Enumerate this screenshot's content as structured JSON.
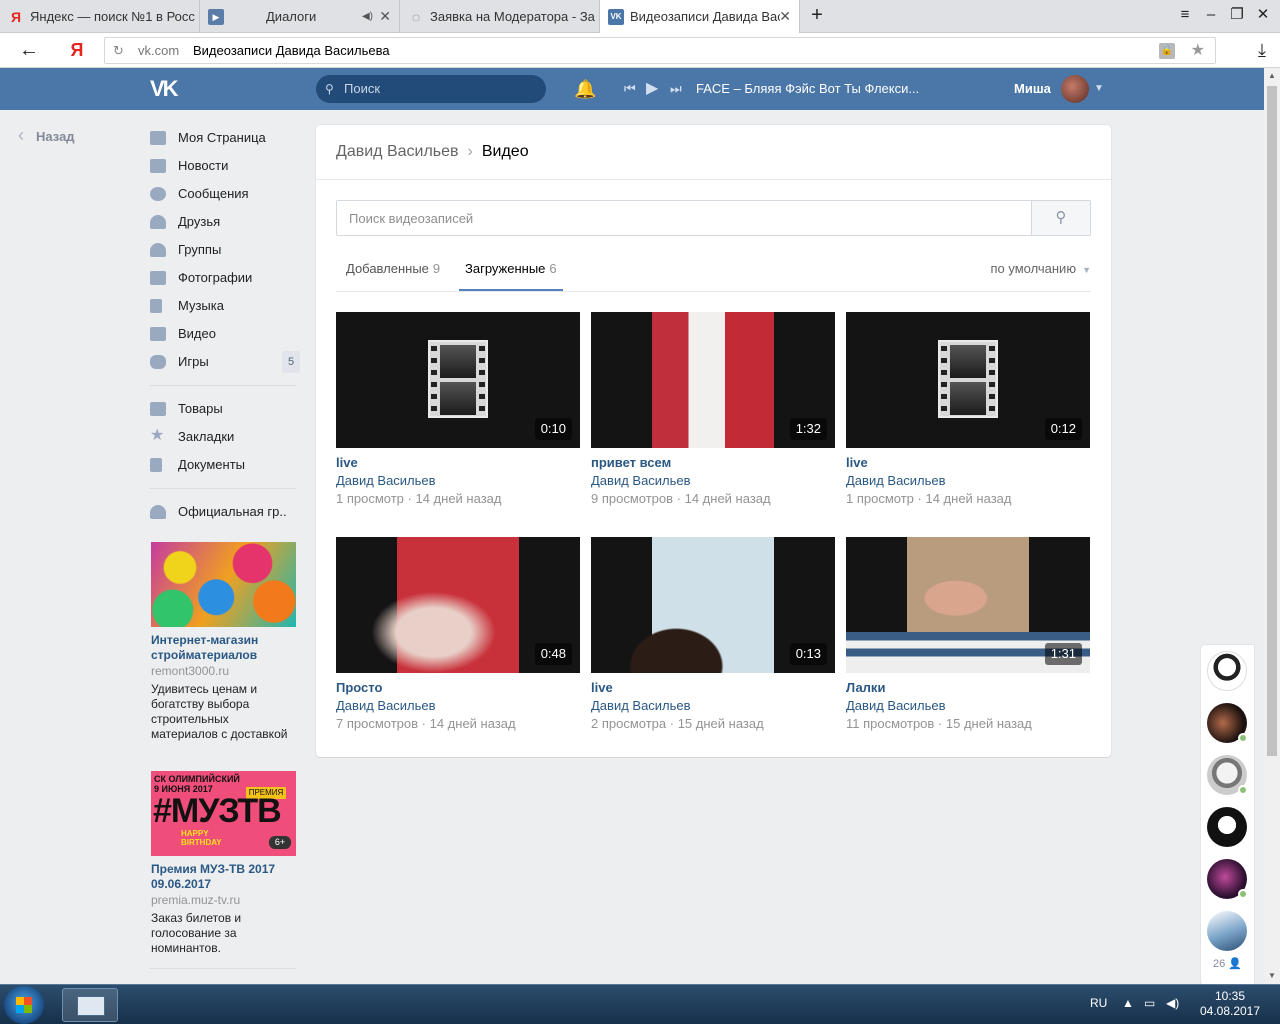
{
  "browser": {
    "tabs": [
      {
        "label": "Яндекс — поиск №1 в Росс",
        "icon": "yandex-icon"
      },
      {
        "label": "Диалоги",
        "icon": "play-icon"
      },
      {
        "label": "Заявка на Модератора - За",
        "icon": "loading-icon"
      },
      {
        "label": "Видеозаписи Давида Вас",
        "icon": "vk-icon"
      }
    ],
    "new_tab": "+",
    "address_domain": "vk.com",
    "address_title": "Видеозаписи Давида Васильева"
  },
  "header": {
    "logo": "VK",
    "search_placeholder": "Поиск",
    "now_playing": "FACE – Бляяя Фэйс Вот Ты Флекси...",
    "user_name": "Миша"
  },
  "back_label": "Назад",
  "menu": {
    "main": [
      {
        "label": "Моя Страница",
        "icon": "home-icon"
      },
      {
        "label": "Новости",
        "icon": "news-icon"
      },
      {
        "label": "Сообщения",
        "icon": "messages-icon"
      },
      {
        "label": "Друзья",
        "icon": "friends-icon"
      },
      {
        "label": "Группы",
        "icon": "groups-icon"
      },
      {
        "label": "Фотографии",
        "icon": "camera-icon"
      },
      {
        "label": "Музыка",
        "icon": "music-icon"
      },
      {
        "label": "Видео",
        "icon": "video-icon"
      },
      {
        "label": "Игры",
        "icon": "gamepad-icon",
        "badge": "5"
      }
    ],
    "secondary": [
      {
        "label": "Товары",
        "icon": "bag-icon"
      },
      {
        "label": "Закладки",
        "icon": "star-icon"
      },
      {
        "label": "Документы",
        "icon": "document-icon"
      }
    ],
    "groups": [
      {
        "label": "Официальная гр..",
        "icon": "group-icon"
      }
    ]
  },
  "ads": [
    {
      "title": "Интернет-магазин стройматериалов",
      "domain": "remont3000.ru",
      "text": "Удивитесь ценам и богатству выбора строительных материалов с доставкой"
    },
    {
      "image_text_top": "СК ОЛИМПИЙСКИЙ 9 ИЮНЯ 2017",
      "image_text_big": "#МУЗТВ",
      "image_text_prem": "ПРЕМИЯ",
      "image_text_bday": "HAPPY BIRTHDAY",
      "image_age": "6+",
      "title": "Премия МУЗ-ТВ 2017 09.06.2017",
      "domain": "premia.muz-tv.ru",
      "text": "Заказ билетов и голосование за номинантов."
    }
  ],
  "main": {
    "breadcrumb_parent": "Давид Васильев",
    "breadcrumb_sep": "›",
    "breadcrumb_current": "Видео",
    "search_placeholder": "Поиск видеозаписей",
    "tabs": [
      {
        "label": "Добавленные",
        "count": "9"
      },
      {
        "label": "Загруженные",
        "count": "6"
      }
    ],
    "sort_label": "по умолчанию",
    "videos": [
      {
        "title": "live",
        "author": "Давид Васильев",
        "views": "1 просмотр",
        "age": "14 дней назад",
        "duration": "0:10",
        "thumb": "placeholder"
      },
      {
        "title": "привет всем",
        "author": "Давид Васильев",
        "views": "9 просмотров",
        "age": "14 дней назад",
        "duration": "1:32",
        "thumb": "red-wall"
      },
      {
        "title": "live",
        "author": "Давид Васильев",
        "views": "1 просмотр",
        "age": "14 дней назад",
        "duration": "0:12",
        "thumb": "placeholder"
      },
      {
        "title": "Просто",
        "author": "Давид Васильев",
        "views": "7 просмотров",
        "age": "14 дней назад",
        "duration": "0:48",
        "thumb": "red-hand"
      },
      {
        "title": "live",
        "author": "Давид Васильев",
        "views": "2 просмотра",
        "age": "15 дней назад",
        "duration": "0:13",
        "thumb": "tiles"
      },
      {
        "title": "Лалки",
        "author": "Давид Васильев",
        "views": "11 просмотров",
        "age": "15 дней назад",
        "duration": "1:31",
        "thumb": "boy"
      }
    ]
  },
  "chat_count": "26",
  "taskbar": {
    "lang": "RU",
    "time": "10:35",
    "date": "04.08.2017"
  },
  "colors": {
    "vk_blue": "#4a76a8",
    "link": "#2a5885",
    "page_bg": "#edeef0"
  }
}
